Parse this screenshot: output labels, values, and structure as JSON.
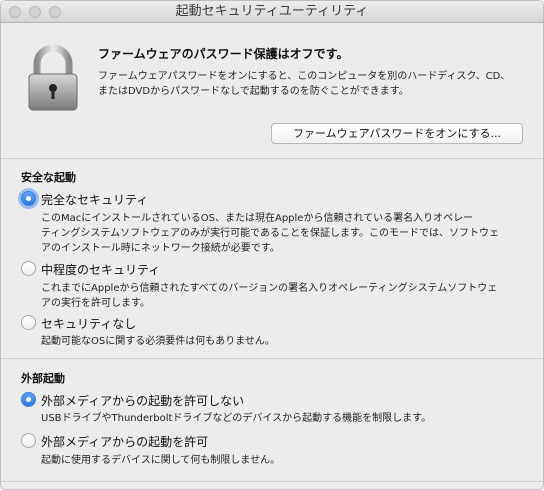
{
  "window": {
    "title": "起動セキュリティユーティリティ"
  },
  "firmware": {
    "heading": "ファームウェアのパスワード保護はオフです。",
    "description_line1": "ファームウェアパスワードをオンにすると、このコンピュータを別のハードディスク、CD、",
    "description_line2": "またはDVDからパスワードなしで起動するのを防ぐことができます。",
    "button_label": "ファームウェアパスワードをオンにする..."
  },
  "secure_boot": {
    "heading": "安全な起動",
    "options": [
      {
        "label": "完全なセキュリティ",
        "selected": true,
        "desc_lines": [
          "このMacにインストールされているOS、または現在Appleから信頼されている署名入りオペレー",
          "ティングシステムソフトウェアのみが実行可能であることを保証します。このモードでは、ソフトウェ",
          "アのインストール時にネットワーク接続が必要です。"
        ]
      },
      {
        "label": "中程度のセキュリティ",
        "selected": false,
        "desc_lines": [
          "これまでにAppleから信頼されたすべてのバージョンの署名入りオペレーティングシステムソフトウェ",
          "アの実行を許可します。"
        ]
      },
      {
        "label": "セキュリティなし",
        "selected": false,
        "desc_lines": [
          "起動可能なOSに関する必須要件は何もありません。"
        ]
      }
    ]
  },
  "external_boot": {
    "heading": "外部起動",
    "options": [
      {
        "label": "外部メディアからの起動を許可しない",
        "selected": true,
        "desc_lines": [
          "USBドライブやThunderboltドライブなどのデバイスから起動する機能を制限します。"
        ]
      },
      {
        "label": "外部メディアからの起動を許可",
        "selected": false,
        "desc_lines": [
          "起動に使用するデバイスに関して何も制限しません。"
        ]
      }
    ]
  },
  "icons": {
    "lock": "lock-icon",
    "traffic_lights": [
      "close-icon",
      "minimize-icon",
      "zoom-icon"
    ]
  },
  "colors": {
    "accent": "#2c78e3",
    "window_bg": "#ececec"
  }
}
